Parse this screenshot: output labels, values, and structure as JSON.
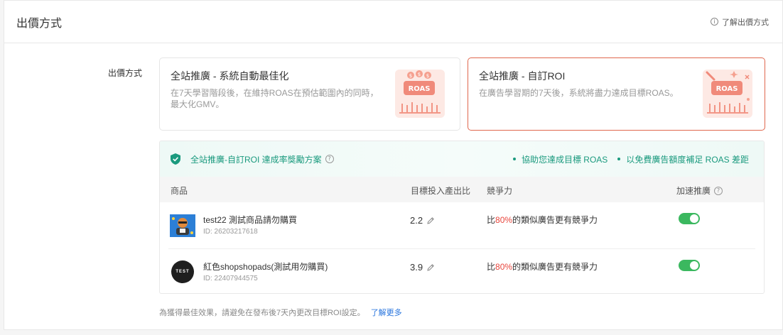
{
  "header": {
    "title": "出價方式",
    "learn_link": "了解出價方式",
    "info_icon": "i"
  },
  "field_label": "出價方式",
  "options": [
    {
      "title": "全站推廣 - 系統自動最佳化",
      "description": "在7天學習階段後，在維持ROAS在預估範圍內的同時，最大化GMV。",
      "illustration_text": "ROAS",
      "selected": false
    },
    {
      "title": "全站推廣 - 自訂ROI",
      "description": "在廣告學習期的7天後，系統將盡力達成目標ROAS。",
      "illustration_text": "ROAS",
      "selected": true
    }
  ],
  "program": {
    "title": "全站推廣-自訂ROI 達成率獎勵方案",
    "help_icon": "?",
    "benefits": [
      "協助您達成目標 ROAS",
      "以免費廣告額度補足 ROAS 差距"
    ]
  },
  "table": {
    "headers": {
      "product": "商品",
      "roas": "目標投入產出比",
      "competitiveness": "競爭力",
      "boost": "加速推廣",
      "boost_help": "?"
    },
    "rows": [
      {
        "name": "test22 測試商品請勿購買",
        "id": "ID: 26203217618",
        "roas": "2.2",
        "comp_prefix": "比",
        "comp_pct": "80%",
        "comp_suffix": "的類似廣告更有競爭力",
        "boost_on": true,
        "thumb": "cartoon-product-image"
      },
      {
        "name": "紅色shopshopads(測試用勿購買)",
        "id": "ID: 22407944575",
        "roas": "3.9",
        "comp_prefix": "比",
        "comp_pct": "80%",
        "comp_suffix": "的類似廣告更有競爭力",
        "boost_on": true,
        "thumb_text": "TEST"
      }
    ]
  },
  "footnote": {
    "text": "為獲得最佳效果，請避免在發布後7天內更改目標ROI設定。",
    "link": "了解更多"
  },
  "colors": {
    "accent_green": "#1a9a7e",
    "toggle_green": "#3bb85f",
    "selected_border": "#e0674d",
    "percent_red": "#e8453c",
    "link_blue": "#2673dd",
    "illustration_bg": "#fde9e4",
    "illustration_fg": "#f08a7a"
  }
}
